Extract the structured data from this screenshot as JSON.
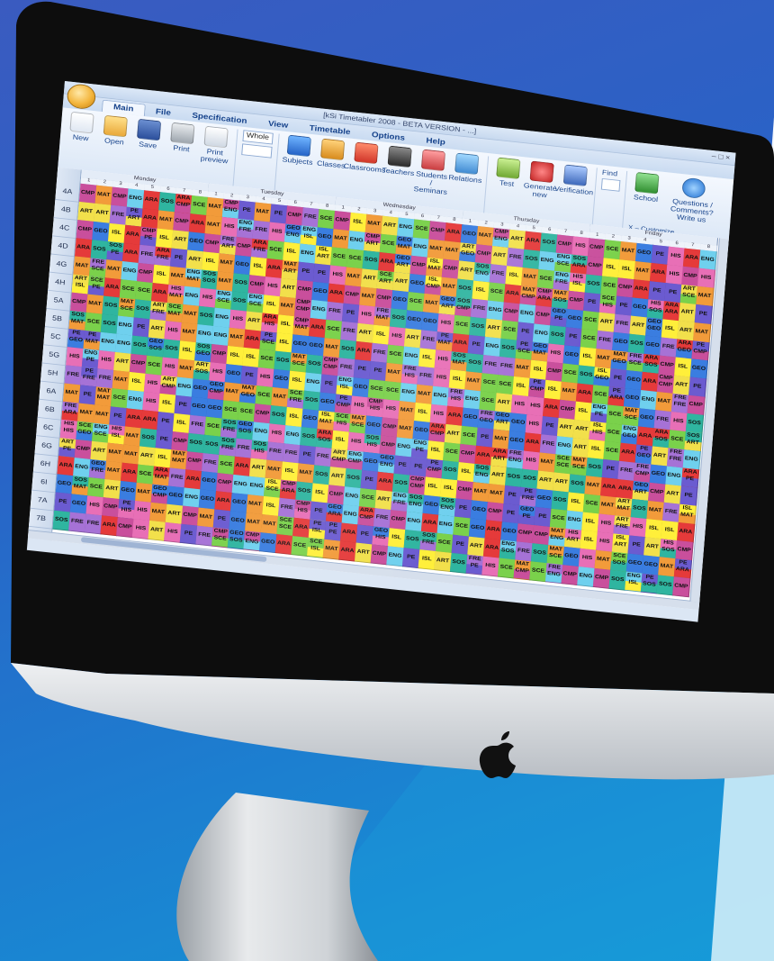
{
  "app": {
    "window_title": "[kSi Timetabler 2008 - BETA VERSION - ...]",
    "window_buttons": "– □ ×",
    "tabs": [
      {
        "label": "Main",
        "active": true
      },
      {
        "label": "File",
        "active": false
      },
      {
        "label": "Specification",
        "active": false
      },
      {
        "label": "View",
        "active": false
      },
      {
        "label": "Timetable",
        "active": false
      },
      {
        "label": "Options",
        "active": false
      },
      {
        "label": "Help",
        "active": false
      }
    ],
    "ribbon": {
      "file_buttons": [
        {
          "label": "New",
          "icon": "new-document-icon"
        },
        {
          "label": "Open",
          "icon": "open-folder-icon"
        },
        {
          "label": "Save",
          "icon": "save-disk-icon"
        },
        {
          "label": "Print",
          "icon": "printer-icon"
        },
        {
          "label": "Print preview",
          "icon": "print-preview-icon"
        }
      ],
      "view_label": "Whole",
      "spec_buttons": [
        {
          "label": "Subjects",
          "icon": "book-icon"
        },
        {
          "label": "Classes",
          "icon": "classes-icon"
        },
        {
          "label": "Classrooms",
          "icon": "house-icon"
        },
        {
          "label": "Teachers",
          "icon": "teacher-icon"
        },
        {
          "label": "Students / Seminars",
          "icon": "students-icon"
        },
        {
          "label": "Relations",
          "icon": "relations-icon"
        }
      ],
      "generate_buttons": [
        {
          "label": "Test",
          "icon": "test-icon"
        },
        {
          "label": "Generate new",
          "icon": "generate-icon"
        },
        {
          "label": "Verification",
          "icon": "verify-icon"
        }
      ],
      "find_label": "Find",
      "help_buttons": [
        {
          "label": "School",
          "icon": "school-icon"
        },
        {
          "label": "Questions / Comments? Write us",
          "icon": "question-icon"
        }
      ],
      "close_link": "X – Customize"
    },
    "days": [
      "Monday",
      "Tuesday",
      "Wednesday",
      "Thursday",
      "Friday"
    ],
    "periods": [
      "1",
      "2",
      "3",
      "4",
      "5",
      "6",
      "7",
      "8"
    ],
    "classes": [
      "4A",
      "4B",
      "4C",
      "4D",
      "4G",
      "4H",
      "5A",
      "5B",
      "5C",
      "5G",
      "5H",
      "6A",
      "6B",
      "6C",
      "6G",
      "6H",
      "6I",
      "7A",
      "7B"
    ],
    "subjects": [
      "ENG",
      "MAT",
      "SCE",
      "SOS",
      "ART",
      "CMP",
      "ISL",
      "ARA",
      "FRE",
      "GEO",
      "HIS",
      "PE"
    ],
    "subject_colors": {
      "ENG": "#6fd0ee",
      "MAT": "#f29b3a",
      "SCE": "#7ad14b",
      "SOS": "#2fb5a0",
      "ART": "#f2e04b",
      "CMP": "#c94f9c",
      "ISL": "#ffef3a",
      "ARA": "#e53a3a",
      "FRE": "#a672d6",
      "GEO": "#3a7de0",
      "HIS": "#e86fb6",
      "PE": "#6b5bd0"
    }
  }
}
